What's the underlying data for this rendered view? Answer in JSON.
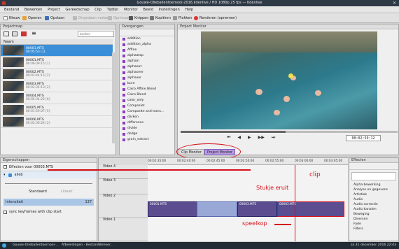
{
  "window": {
    "title": "Gouwe-Olieballentoernooi-2016.kdenlive / HD 1080p 25 fps — Kdenlive"
  },
  "menu": [
    "Bestand",
    "Bewerken",
    "Project",
    "Gereedschap",
    "Clip",
    "Tijdlijn",
    "Monitor",
    "Beeld",
    "Instellingen",
    "Help"
  ],
  "toolbar": {
    "items": [
      "Nieuw",
      "Openen",
      "Opslaan",
      "Ongedaan maken",
      "Opnieuw",
      "Knippen",
      "Kopiëren",
      "Plakken",
      "Renderen (opnemen)"
    ]
  },
  "project_bin": {
    "title": "Projectmap",
    "search_placeholder": "Zoeken",
    "column": "Naam",
    "clips": [
      {
        "name": "00001.MTS",
        "dur": "00:05:53 [1]"
      },
      {
        "name": "00001.MTS",
        "dur": "00:06:09:15 [1]"
      },
      {
        "name": "00002.MTS",
        "dur": "00:02:44:15 [2]"
      },
      {
        "name": "00003.MTS",
        "dur": "00:02:35:13 [2]"
      },
      {
        "name": "00004.MTS",
        "dur": "00:05:34:22 [6]"
      },
      {
        "name": "00005.MTS",
        "dur": "00:01:59:07 [5]"
      },
      {
        "name": "00006.MTS",
        "dur": "00:02:36:24 [2]"
      }
    ]
  },
  "transitions": {
    "title": "Overgangen",
    "items": [
      "addition",
      "addition_alpha",
      "Affine",
      "alphaatop",
      "alphain",
      "alphaout",
      "alphaover",
      "alphaxor",
      "burn",
      "Cairo Affine Blend",
      "Cairo Blend",
      "color_only",
      "Composiet",
      "Composite and trans...",
      "darken",
      "difference",
      "divide",
      "dodge",
      "grain_extract"
    ]
  },
  "monitor": {
    "title": "Project Monitor",
    "timecode": "00:02:59:12",
    "tabs": [
      "Clip Monitor",
      "Project Monitor"
    ],
    "active_tab": "Project Monitor"
  },
  "properties": {
    "title": "Eigenschappen",
    "effect_header": "Effecten voor 00003.MTS",
    "effect_name": "alleb",
    "mode_label": "Standaard",
    "mode_right": "Lineair",
    "intensity_label": "Intensiteit",
    "intensity_value": "137",
    "sync_label": "sync keyframes with clip start"
  },
  "timeline": {
    "ticks": [
      "00:02:35:00",
      "00:02:40:00",
      "00:02:45:00",
      "00:02:50:00",
      "00:02:55:00",
      "00:03:00:00",
      "00:03:05:00"
    ],
    "tracks": [
      "Video 4",
      "Video 3",
      "Video 2",
      "Video 1"
    ],
    "clip_labels": [
      "00001.MTS",
      "00003.MTS",
      "00003.MTS"
    ]
  },
  "annotations": {
    "clip": "clip",
    "stukje": "Stukje eruit",
    "speelkop": "speelkop"
  },
  "effects": {
    "title": "Effecten",
    "items": [
      "Alpha bewerking",
      "Analyse en gegevens",
      "Artistiek",
      "Audio",
      "Audio correctie",
      "Audio kanalen",
      "Beweging",
      "Diversen",
      "Fade",
      "Filters"
    ]
  },
  "taskbar": {
    "items": [
      "Gouwe-Olieballentoernooi-...",
      "Afbeeldingen - BestandBeheer..."
    ],
    "clock": "za 31 december 2016  22:43"
  },
  "colors": {
    "accent": "#3a8fd8",
    "annotation": "#d4101a",
    "monitor_tab_highlight": "#b99be0"
  }
}
